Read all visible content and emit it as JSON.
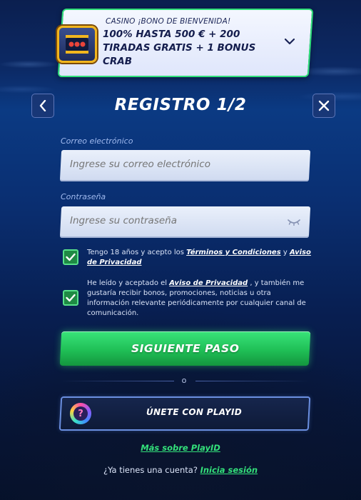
{
  "bonus": {
    "small_label": "CASINO ¡BONO DE BIENVENIDA!",
    "line1": "100% HASTA 500 € + 200",
    "line2": "TIRADAS GRATIS + 1 BONUS",
    "line3": "CRAB",
    "icon": "slot-machine-icon",
    "expand_icon": "chevron-down-icon"
  },
  "header": {
    "title": "REGISTRO 1/2",
    "back_icon": "chevron-left-icon",
    "close_icon": "close-icon"
  },
  "form": {
    "email_label": "Correo electrónico",
    "email_placeholder": "Ingrese su correo electrónico",
    "email_value": "",
    "password_label": "Contraseña",
    "password_placeholder": "Ingrese su contraseña",
    "password_value": "",
    "password_toggle_icon": "eye-closed-icon"
  },
  "consents": {
    "age": {
      "checked": true,
      "text_before": "Tengo 18 años y acepto los ",
      "terms_link": "Términos y Condiciones",
      "text_mid": " y ",
      "privacy_link": "Aviso de Privacidad"
    },
    "marketing": {
      "checked": true,
      "text_before": "He leído y aceptado el ",
      "privacy_link": "Aviso de Privacidad",
      "text_after": " , y también me gustaría recibir bonos, promociones, noticias u otra información relevante periódicamente por cualquier canal de comunicación."
    }
  },
  "actions": {
    "next_label": "SIGUIENTE PASO",
    "divider_text": "o",
    "playid_label": "ÚNETE CON PLAYID",
    "more_playid_link": "Más sobre PlayID",
    "login_prompt": "¿Ya tienes una cuenta? ",
    "login_link": "Inicia sesión"
  },
  "colors": {
    "accent_green": "#33e07a",
    "button_green": "#1fbf56",
    "background_blue": "#0b2a66",
    "card_border": "#2fe07a"
  }
}
